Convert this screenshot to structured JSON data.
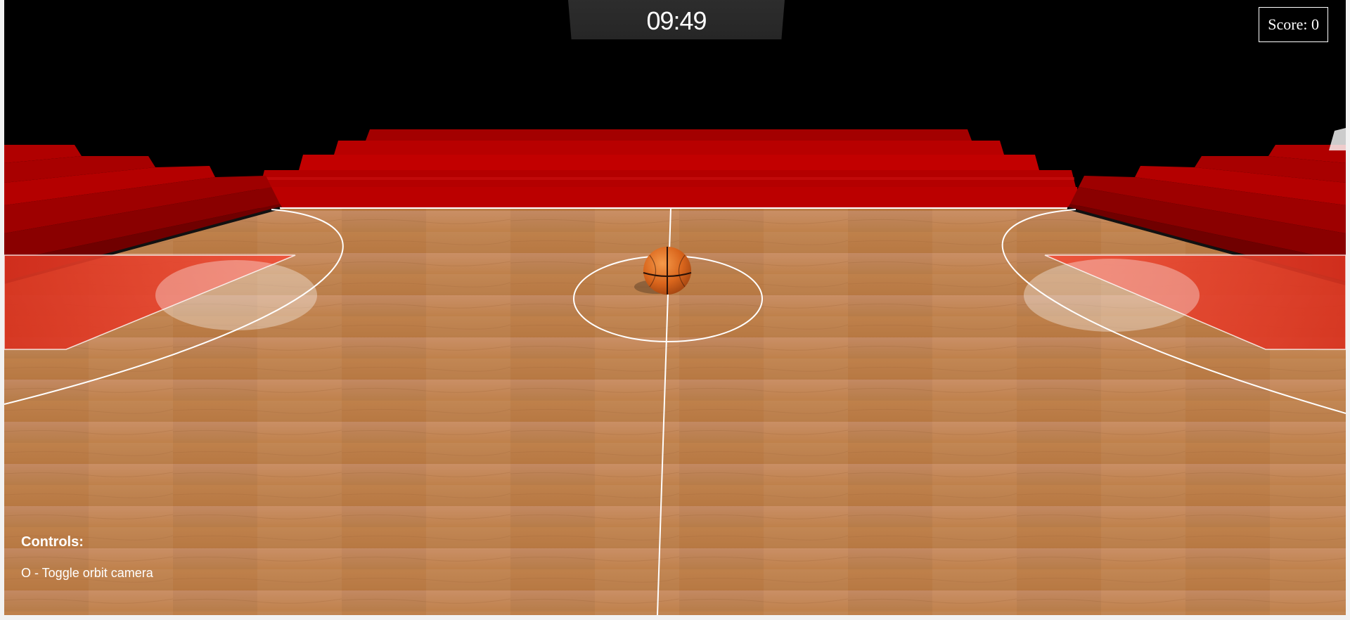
{
  "hud": {
    "timer": "09:49",
    "score": "Score: 0"
  },
  "controls": {
    "title": "Controls:",
    "items": [
      "O - Toggle orbit camera"
    ]
  },
  "colors": {
    "background": "#000000",
    "bleachers": "#b00000",
    "floor_wood": "#c98a55",
    "paint_area": "#e5402a",
    "court_lines": "#ffffff",
    "ball": "#e0701e"
  }
}
